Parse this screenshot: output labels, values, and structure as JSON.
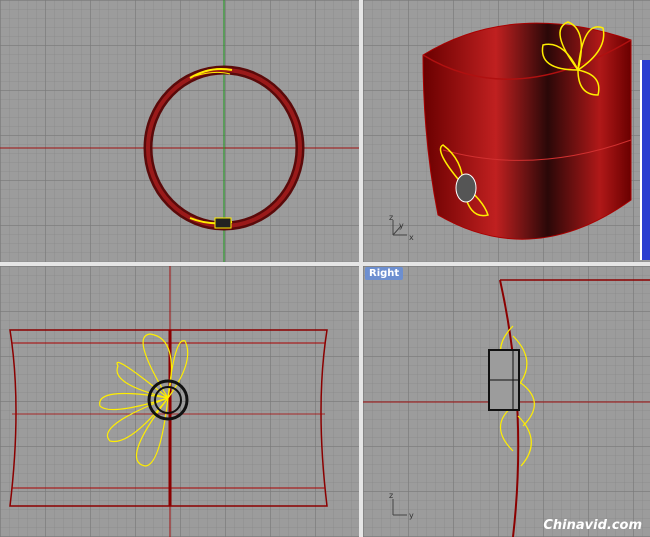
{
  "viewports": {
    "right": {
      "label": "Right"
    }
  },
  "axes": {
    "x": "x",
    "y": "y",
    "z": "z"
  },
  "watermark": "Chinavid.com",
  "colors": {
    "grid_bg": "#9c9c9c",
    "object": "#8b0000",
    "selection": "#ffee00",
    "label_bg": "#6d8fd0"
  }
}
